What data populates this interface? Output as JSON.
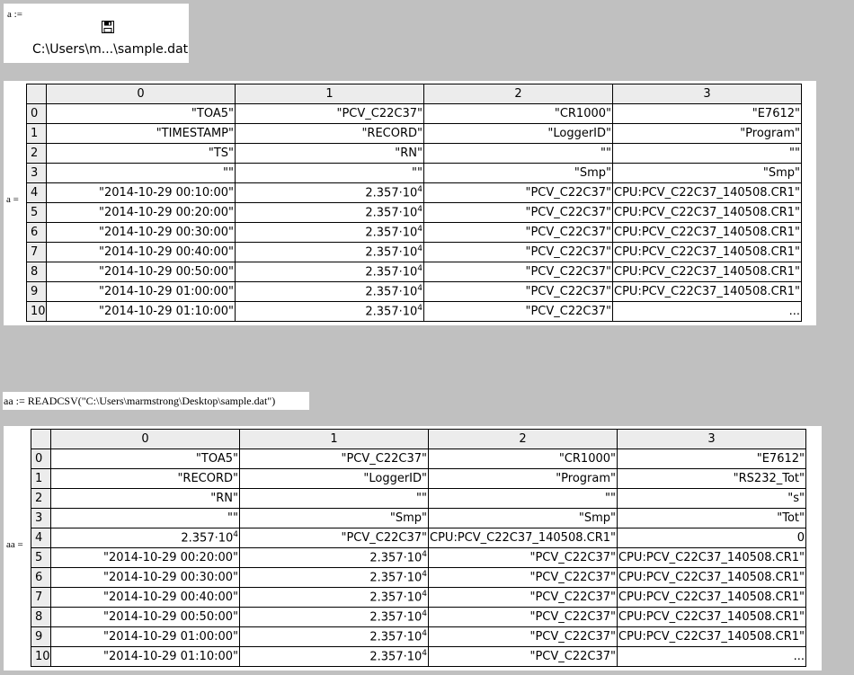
{
  "file_region": {
    "assign_label": "a :=",
    "icon": "save-disk-icon",
    "path": "C:\\Users\\m...\\sample.dat"
  },
  "matrix_a": {
    "label": "a =",
    "columns": [
      "0",
      "1",
      "2",
      "3"
    ],
    "rows": [
      {
        "index": "0",
        "cells": [
          "\"TOA5\"",
          "\"PCV_C22C37\"",
          "\"CR1000\"",
          "\"E7612\""
        ]
      },
      {
        "index": "1",
        "cells": [
          "\"TIMESTAMP\"",
          "\"RECORD\"",
          "\"LoggerID\"",
          "\"Program\""
        ]
      },
      {
        "index": "2",
        "cells": [
          "\"TS\"",
          "\"RN\"",
          "\"\"",
          "\"\""
        ]
      },
      {
        "index": "3",
        "cells": [
          "\"\"",
          "\"\"",
          "\"Smp\"",
          "\"Smp\""
        ]
      },
      {
        "index": "4",
        "cells": [
          "\"2014-10-29 00:10:00\"",
          "2.357·10^4",
          "\"PCV_C22C37\"",
          "\"CPU:PCV_C22C37_140508.CR1\""
        ]
      },
      {
        "index": "5",
        "cells": [
          "\"2014-10-29 00:20:00\"",
          "2.357·10^4",
          "\"PCV_C22C37\"",
          "\"CPU:PCV_C22C37_140508.CR1\""
        ]
      },
      {
        "index": "6",
        "cells": [
          "\"2014-10-29 00:30:00\"",
          "2.357·10^4",
          "\"PCV_C22C37\"",
          "\"CPU:PCV_C22C37_140508.CR1\""
        ]
      },
      {
        "index": "7",
        "cells": [
          "\"2014-10-29 00:40:00\"",
          "2.357·10^4",
          "\"PCV_C22C37\"",
          "\"CPU:PCV_C22C37_140508.CR1\""
        ]
      },
      {
        "index": "8",
        "cells": [
          "\"2014-10-29 00:50:00\"",
          "2.357·10^4",
          "\"PCV_C22C37\"",
          "\"CPU:PCV_C22C37_140508.CR1\""
        ]
      },
      {
        "index": "9",
        "cells": [
          "\"2014-10-29 01:00:00\"",
          "2.357·10^4",
          "\"PCV_C22C37\"",
          "\"CPU:PCV_C22C37_140508.CR1\""
        ]
      },
      {
        "index": "10",
        "cells": [
          "\"2014-10-29 01:10:00\"",
          "2.357·10^4",
          "\"PCV_C22C37\"",
          "..."
        ]
      }
    ]
  },
  "formula": {
    "text": "aa := READCSV(\"C:\\Users\\marmstrong\\Desktop\\sample.dat\")"
  },
  "matrix_aa": {
    "label": "aa =",
    "columns": [
      "0",
      "1",
      "2",
      "3"
    ],
    "rows": [
      {
        "index": "0",
        "cells": [
          "\"TOA5\"",
          "\"PCV_C22C37\"",
          "\"CR1000\"",
          "\"E7612\""
        ]
      },
      {
        "index": "1",
        "cells": [
          "\"RECORD\"",
          "\"LoggerID\"",
          "\"Program\"",
          "\"RS232_Tot\""
        ]
      },
      {
        "index": "2",
        "cells": [
          "\"RN\"",
          "\"\"",
          "\"\"",
          "\"s\""
        ]
      },
      {
        "index": "3",
        "cells": [
          "\"\"",
          "\"Smp\"",
          "\"Smp\"",
          "\"Tot\""
        ]
      },
      {
        "index": "4",
        "cells": [
          "2.357·10^4",
          "\"PCV_C22C37\"",
          "\"CPU:PCV_C22C37_140508.CR1\"",
          "0"
        ]
      },
      {
        "index": "5",
        "cells": [
          "\"2014-10-29 00:20:00\"",
          "2.357·10^4",
          "\"PCV_C22C37\"",
          "\"CPU:PCV_C22C37_140508.CR1\""
        ]
      },
      {
        "index": "6",
        "cells": [
          "\"2014-10-29 00:30:00\"",
          "2.357·10^4",
          "\"PCV_C22C37\"",
          "\"CPU:PCV_C22C37_140508.CR1\""
        ]
      },
      {
        "index": "7",
        "cells": [
          "\"2014-10-29 00:40:00\"",
          "2.357·10^4",
          "\"PCV_C22C37\"",
          "\"CPU:PCV_C22C37_140508.CR1\""
        ]
      },
      {
        "index": "8",
        "cells": [
          "\"2014-10-29 00:50:00\"",
          "2.357·10^4",
          "\"PCV_C22C37\"",
          "\"CPU:PCV_C22C37_140508.CR1\""
        ]
      },
      {
        "index": "9",
        "cells": [
          "\"2014-10-29 01:00:00\"",
          "2.357·10^4",
          "\"PCV_C22C37\"",
          "\"CPU:PCV_C22C37_140508.CR1\""
        ]
      },
      {
        "index": "10",
        "cells": [
          "\"2014-10-29 01:10:00\"",
          "2.357·10^4",
          "\"PCV_C22C37\"",
          "..."
        ]
      }
    ]
  }
}
